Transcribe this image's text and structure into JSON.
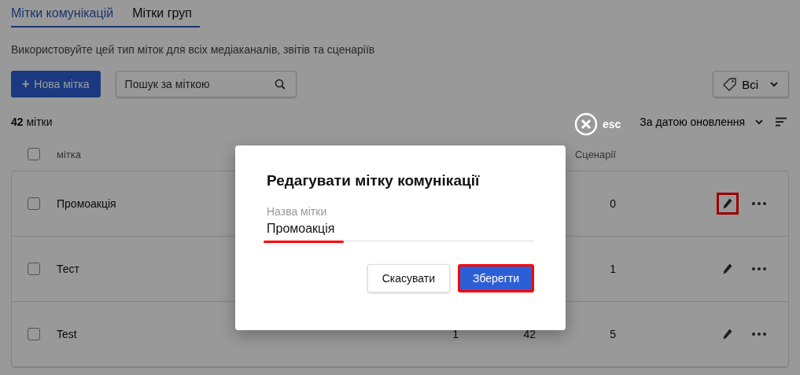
{
  "tabs": [
    {
      "label": "Мітки комунікацій",
      "selected": true
    },
    {
      "label": "Мітки груп",
      "selected": false
    }
  ],
  "description": "Використовуйте цей тип міток для всіх медіаканалів, звітів та сценаріїв",
  "toolbar": {
    "new_button": {
      "icon": "+",
      "label": "Нова мітка"
    },
    "search": {
      "placeholder": "Пошук за міткою"
    },
    "filter": {
      "label": "Всі"
    }
  },
  "summary": {
    "count": "42",
    "unit": "мітки"
  },
  "sort": {
    "label": "За датою оновлення"
  },
  "table": {
    "select_all": {
      "checked": false
    },
    "columns": [
      {
        "label": "мітка"
      },
      {
        "label": "Сценарії"
      }
    ],
    "rows": [
      {
        "name": "Промоакція",
        "checked": false,
        "scenarios": "0",
        "edit_highlighted": true
      },
      {
        "name": "Тест",
        "checked": false,
        "scenarios": "1",
        "edit_highlighted": false
      },
      {
        "name": "Test",
        "checked": false,
        "column_2": "1",
        "column_3": "42",
        "scenarios": "5",
        "edit_highlighted": false
      }
    ]
  },
  "close_hint": {
    "label": "esc"
  },
  "dialog": {
    "title": "Редагувати мітку комунікації",
    "field": {
      "label": "Назва мітки",
      "value": "Промоакція",
      "highlighted": true
    },
    "buttons": [
      {
        "kind": "secondary",
        "label": "Скасувати",
        "highlighted": false
      },
      {
        "kind": "primary",
        "label": "Зберегти",
        "highlighted": true
      }
    ]
  }
}
